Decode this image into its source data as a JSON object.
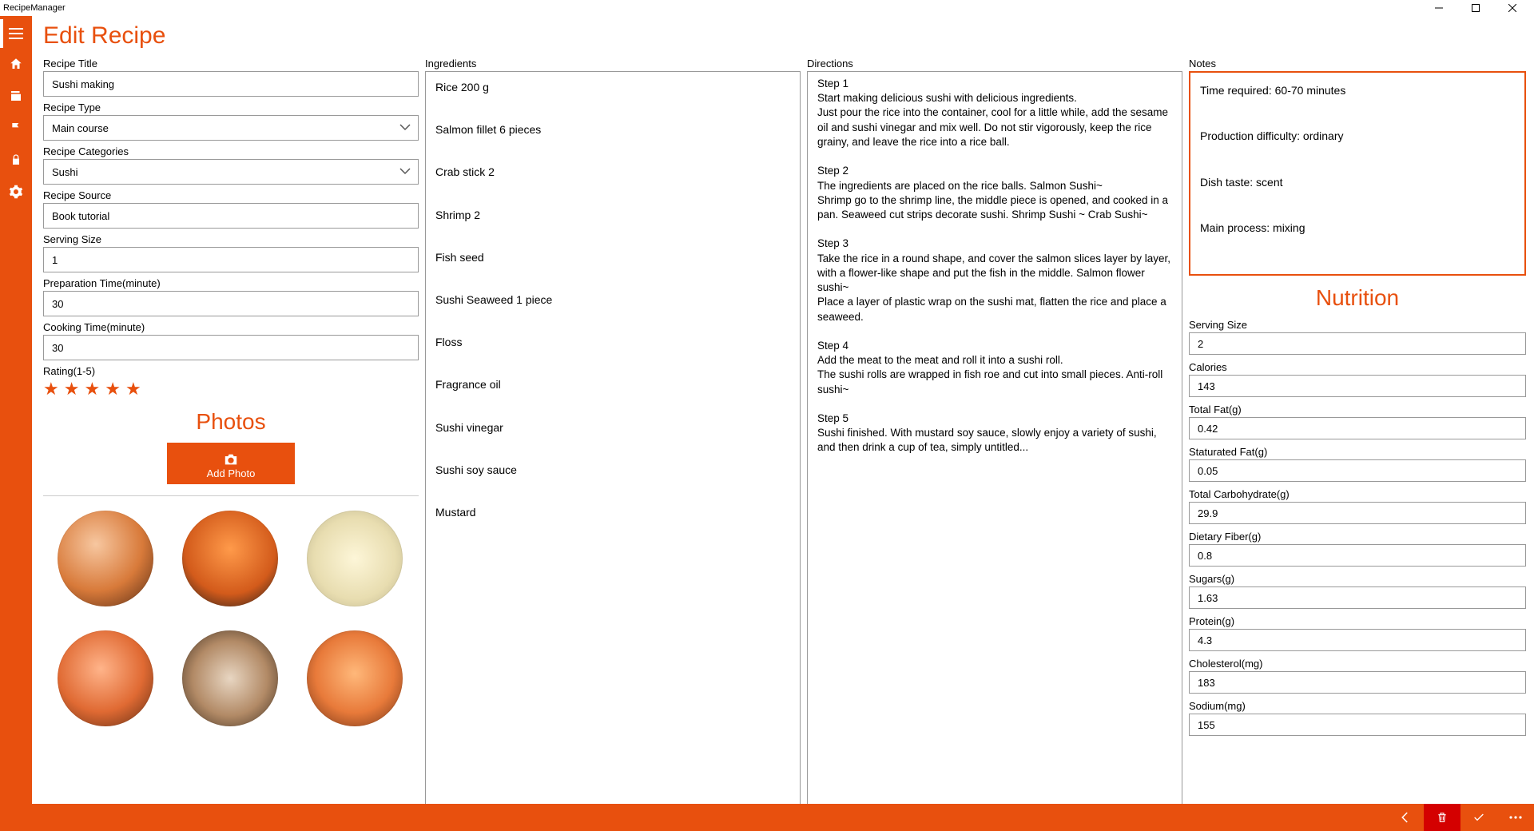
{
  "window": {
    "title": "RecipeManager"
  },
  "page": {
    "title": "Edit Recipe"
  },
  "rail": {
    "items": [
      "menu",
      "home",
      "recipes",
      "flag",
      "lock",
      "settings"
    ]
  },
  "form": {
    "recipe_title_label": "Recipe Title",
    "recipe_title": "Sushi making",
    "recipe_type_label": "Recipe Type",
    "recipe_type": "Main course",
    "recipe_categories_label": "Recipe Categories",
    "recipe_categories": "Sushi",
    "recipe_source_label": "Recipe Source",
    "recipe_source": "Book tutorial",
    "serving_size_label": "Serving Size",
    "serving_size": "1",
    "prep_time_label": "Preparation Time(minute)",
    "prep_time": "30",
    "cook_time_label": "Cooking Time(minute)",
    "cook_time": "30",
    "rating_label": "Rating(1-5)",
    "rating": 5
  },
  "photos": {
    "heading": "Photos",
    "add_label": "Add Photo",
    "items": [
      "sushi-platter-1",
      "salmon-slices",
      "rice-ball",
      "nigiri-mix",
      "assorted-sushi",
      "salmon-rose"
    ]
  },
  "ingredients": {
    "label": "Ingredients",
    "text": "Rice 200 g\n\nSalmon fillet 6 pieces\n\nCrab stick 2\n\nShrimp 2\n\nFish seed\n\nSushi Seaweed 1 piece\n\nFloss\n\nFragrance oil\n\nSushi vinegar\n\nSushi soy sauce\n\nMustard"
  },
  "directions": {
    "label": "Directions",
    "text": "Step 1\nStart making delicious sushi with delicious ingredients.\nJust pour the rice into the container, cool for a little while, add the sesame oil and sushi vinegar and mix well. Do not stir vigorously, keep the rice grainy, and leave the rice into a rice ball.\n\nStep 2\nThe ingredients are placed on the rice balls. Salmon Sushi~\nShrimp go to the shrimp line, the middle piece is opened, and cooked in a pan. Seaweed cut strips decorate sushi. Shrimp Sushi ~ Crab Sushi~\n\nStep 3\nTake the rice in a round shape, and cover the salmon slices layer by layer, with a flower-like shape and put the fish in the middle. Salmon flower sushi~\nPlace a layer of plastic wrap on the sushi mat, flatten the rice and place a seaweed.\n\nStep 4\nAdd the meat to the meat and roll it into a sushi roll.\nThe sushi rolls are wrapped in fish roe and cut into small pieces. Anti-roll sushi~\n\nStep 5\nSushi finished. With mustard soy sauce, slowly enjoy a variety of sushi, and then drink a cup of tea, simply untitled..."
  },
  "notes": {
    "label": "Notes",
    "text": "Time required: 60-70 minutes\n\nProduction difficulty: ordinary\n\nDish taste: scent\n\nMain process: mixing"
  },
  "nutrition": {
    "heading": "Nutrition",
    "serving_size_label": "Serving Size",
    "serving_size": "2",
    "calories_label": "Calories",
    "calories": "143",
    "total_fat_label": "Total Fat(g)",
    "total_fat": "0.42",
    "sat_fat_label": "Staturated Fat(g)",
    "sat_fat": "0.05",
    "carb_label": "Total Carbohydrate(g)",
    "carb": "29.9",
    "fiber_label": "Dietary Fiber(g)",
    "fiber": "0.8",
    "sugars_label": "Sugars(g)",
    "sugars": "1.63",
    "protein_label": "Protein(g)",
    "protein": "4.3",
    "chol_label": "Cholesterol(mg)",
    "chol": "183",
    "sodium_label": "Sodium(mg)",
    "sodium": "155"
  }
}
